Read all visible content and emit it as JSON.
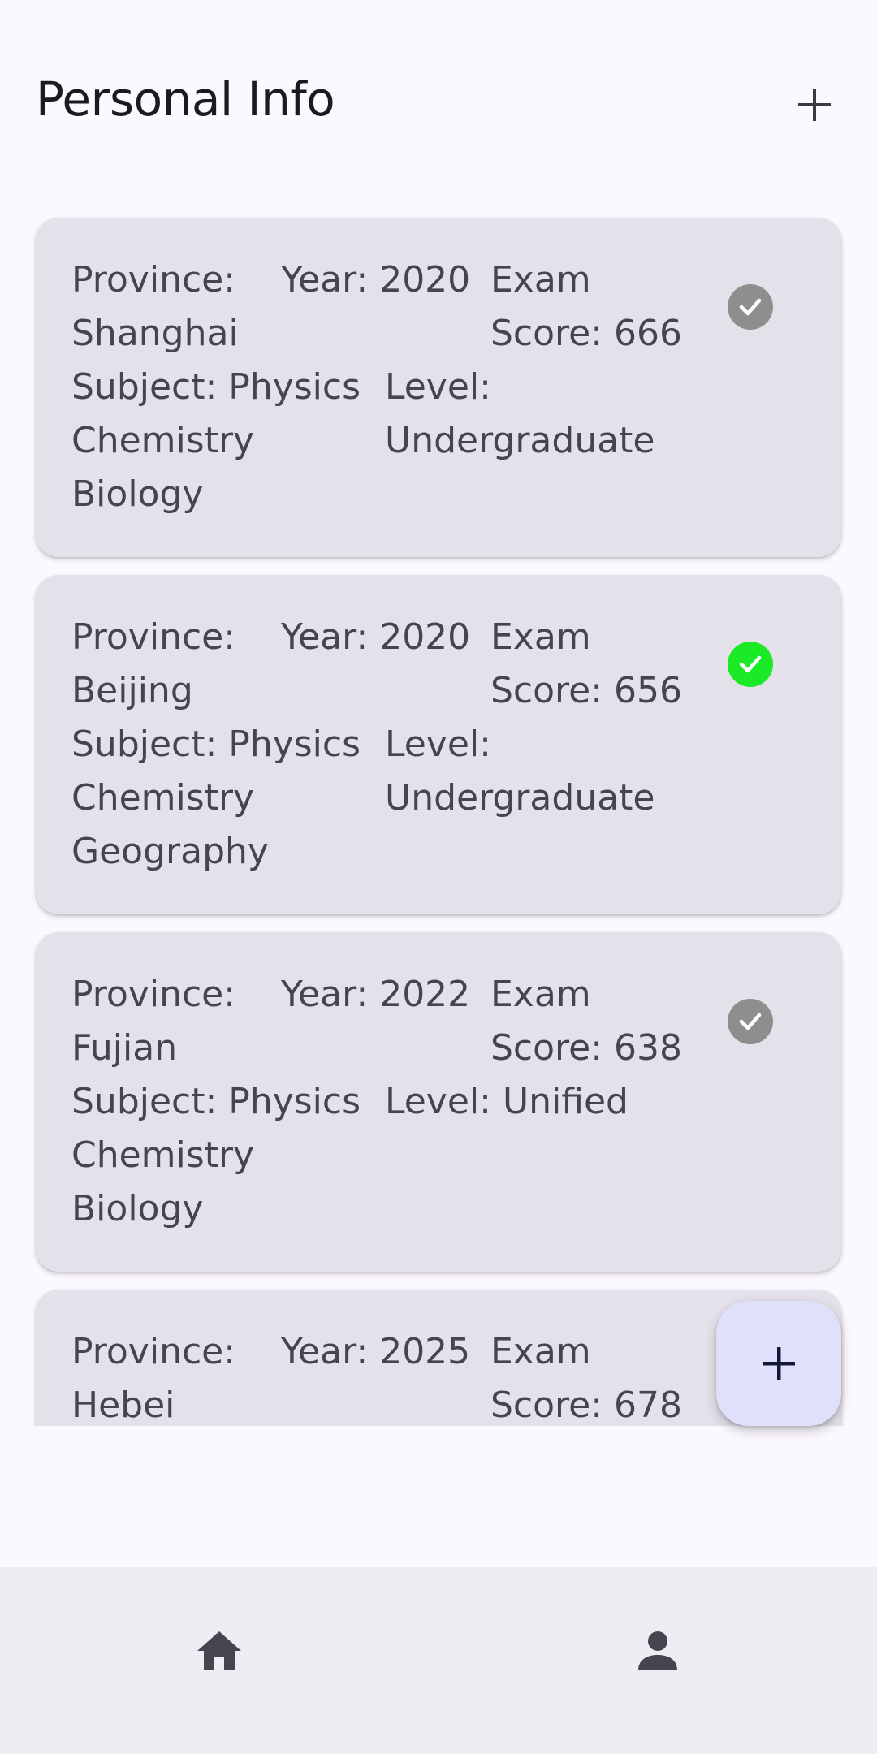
{
  "header": {
    "title": "Personal Info",
    "add_icon": "plus-icon"
  },
  "records": [
    {
      "province": "Province: Shanghai",
      "year": "Year: 2020",
      "score": "Exam Score: 666",
      "subject": "Subject: Physics Chemistry Biology",
      "level": "Level: Undergraduate",
      "selected": false,
      "check_color": "#8e8e8e"
    },
    {
      "province": "Province: Beijing",
      "year": "Year: 2020",
      "score": "Exam Score: 656",
      "subject": "Subject: Physics Chemistry Geography",
      "level": "Level: Undergraduate",
      "selected": true,
      "check_color": "#1bea26"
    },
    {
      "province": "Province: Fujian",
      "year": "Year: 2022",
      "score": "Exam Score: 638",
      "subject": "Subject: Physics Chemistry Biology",
      "level": "Level: Unified",
      "selected": false,
      "check_color": "#8e8e8e"
    },
    {
      "province": "Province: Hebei",
      "year": "Year: 2025",
      "score": "Exam Score: 678",
      "subject": "",
      "level": "",
      "selected": false,
      "check_color": "#8e8e8e"
    }
  ],
  "fab": {
    "icon": "plus-icon"
  },
  "bottom_nav": {
    "items": [
      {
        "icon": "home-icon"
      },
      {
        "icon": "person-icon"
      }
    ]
  },
  "colors": {
    "background": "#fbf8fe",
    "card": "#e4e1ea",
    "fab": "#dfe0f9",
    "nav": "#efedf4",
    "selected_check": "#1bea26",
    "unselected_check": "#8e8e8e"
  }
}
